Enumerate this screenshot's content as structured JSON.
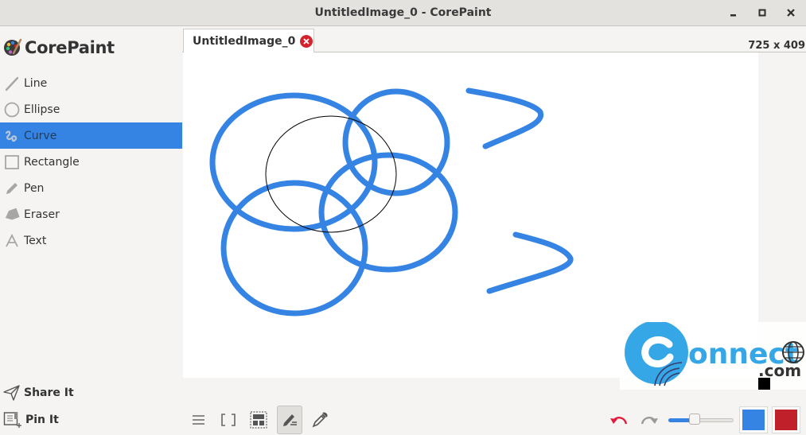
{
  "window": {
    "title": "UntitledImage_0 - CorePaint",
    "controls": [
      "minimize",
      "maximize",
      "close"
    ]
  },
  "sidebar": {
    "brand": "CorePaint",
    "tools": [
      {
        "label": "Line",
        "icon": "line-icon",
        "active": false
      },
      {
        "label": "Ellipse",
        "icon": "ellipse-icon",
        "active": false
      },
      {
        "label": "Curve",
        "icon": "curve-icon",
        "active": true
      },
      {
        "label": "Rectangle",
        "icon": "rectangle-icon",
        "active": false
      },
      {
        "label": "Pen",
        "icon": "pen-icon",
        "active": false
      },
      {
        "label": "Eraser",
        "icon": "eraser-icon",
        "active": false
      },
      {
        "label": "Text",
        "icon": "text-icon",
        "active": false
      }
    ],
    "actions": [
      {
        "label": "Share It",
        "icon": "share-icon"
      },
      {
        "label": "Pin It",
        "icon": "pin-icon"
      }
    ]
  },
  "tabs": [
    {
      "label": "UntitledImage_0",
      "active": true,
      "closable": true
    }
  ],
  "canvas": {
    "dimensions_label": "725 x 409",
    "stroke_color": "#3584e4"
  },
  "bottombar": {
    "tools": [
      {
        "name": "menu",
        "icon": "hamburger-menu-icon",
        "pressed": false
      },
      {
        "name": "fullscreen",
        "icon": "fullscreen-icon",
        "pressed": false
      },
      {
        "name": "select-area",
        "icon": "selection-icon",
        "pressed": false
      },
      {
        "name": "draw",
        "icon": "pencil-edit-icon",
        "pressed": true
      },
      {
        "name": "color-picker",
        "icon": "eyedropper-icon",
        "pressed": false
      }
    ],
    "undo_label": "Undo",
    "redo_label": "Redo",
    "brush_size_fraction": 0.38,
    "primary_color": "#3584e4",
    "secondary_color": "#c0202a"
  },
  "watermark": {
    "text_main": "onnect",
    "text_domain": ".com"
  }
}
